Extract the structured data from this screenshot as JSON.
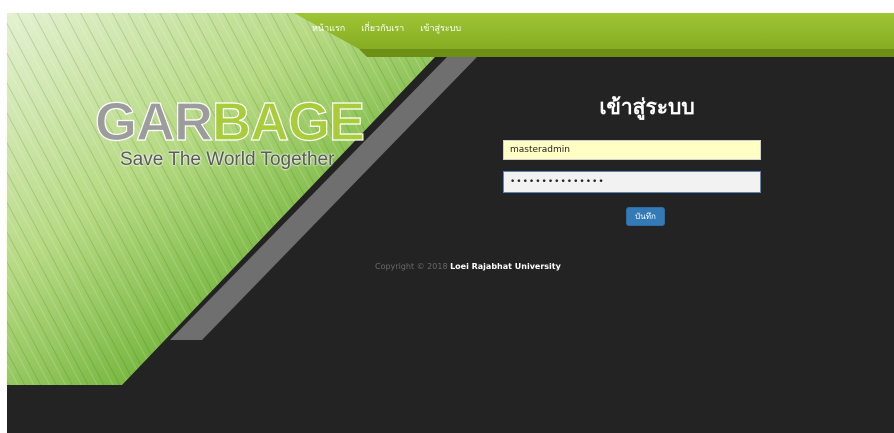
{
  "nav": {
    "items": [
      {
        "label": "หน้าแรก"
      },
      {
        "label": "เกี่ยวกับเรา"
      },
      {
        "label": "เข้าสู่ระบบ"
      }
    ]
  },
  "brand": {
    "logo_part1": "GAR",
    "logo_part2": "BAGE",
    "tagline": "Save The World Together"
  },
  "login": {
    "title": "เข้าสู่ระบบ",
    "username_value": "masteradmin",
    "password_value": "•••••••••••••••",
    "submit_label": "บันทึก"
  },
  "footer": {
    "copyright": "Copyright © 2018 ",
    "organization": "Loei Rajabhat University"
  },
  "colors": {
    "brand_green": "#8fb52a",
    "background_dark": "#232323",
    "button_blue": "#337ab7",
    "username_field_bg": "#ffffc4"
  }
}
